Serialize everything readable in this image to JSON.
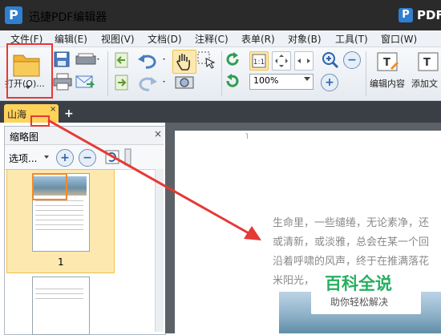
{
  "app": {
    "logo_letter": "P",
    "title": "迅捷PDF编辑器",
    "brand": "PDF"
  },
  "menu": [
    "文件(F)",
    "编辑(E)",
    "视图(V)",
    "文档(D)",
    "注释(C)",
    "表单(R)",
    "对象(B)",
    "工具(T)",
    "窗口(W)"
  ],
  "toolbar": {
    "open_label": "打开(O)...",
    "zoom_value": "100%",
    "edit_content_label": "编辑内容",
    "add_text_label": "添加文"
  },
  "tabs": {
    "active_tab": "山海",
    "close_glyph": "×",
    "new_tab_glyph": "+"
  },
  "thumbnails": {
    "title": "缩略图",
    "close_glyph": "×",
    "options_label": "选项...",
    "zoom_in_glyph": "+",
    "zoom_out_glyph": "−",
    "page1_number": "1"
  },
  "document": {
    "lines": [
      "生命里，一些缱绻，无论素净，还",
      "或清新，或淡雅，总会在某一个回",
      "沿着呼啸的风声，终于在推满落花",
      "米阳光，"
    ]
  },
  "watermark": {
    "title": "百科全说",
    "subtitle": "助你轻松解决"
  },
  "colors": {
    "title_bar": "#2a2a2a",
    "tab_active": "#ffd25a",
    "annotation": "#e53935",
    "watermark": "#27ae60",
    "brand": "#2f7fd0"
  }
}
